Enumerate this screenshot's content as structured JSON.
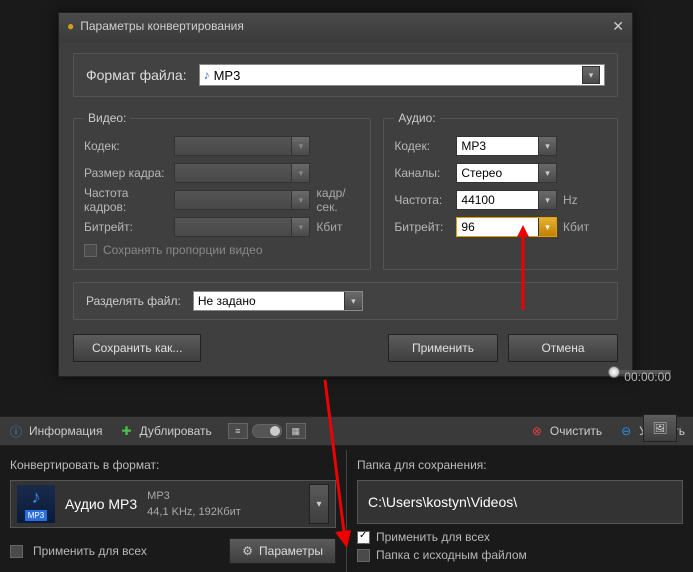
{
  "dialog": {
    "title": "Параметры конвертирования",
    "format_label": "Формат файла:",
    "format_value": "MP3",
    "video": {
      "legend": "Видео:",
      "codec": "Кодек:",
      "framesize": "Размер кадра:",
      "fps": "Частота кадров:",
      "fps_unit": "кадр/сек.",
      "bitrate": "Битрейт:",
      "bitrate_unit": "Кбит",
      "keep_ratio": "Сохранять пропорции видео"
    },
    "audio": {
      "legend": "Аудио:",
      "codec": "Кодек:",
      "codec_val": "MP3",
      "channels": "Каналы:",
      "channels_val": "Стерео",
      "freq": "Частота:",
      "freq_val": "44100",
      "freq_unit": "Hz",
      "bitrate": "Битрейт:",
      "bitrate_val": "96",
      "bitrate_unit": "Кбит"
    },
    "split_label": "Разделять файл:",
    "split_value": "Не задано",
    "save_as": "Сохранить как...",
    "apply": "Применить",
    "cancel": "Отмена"
  },
  "timeline": {
    "time": "00:00:00"
  },
  "toolbar": {
    "info": "Информация",
    "duplicate": "Дублировать",
    "clear": "Очистить",
    "delete": "Удалить"
  },
  "convert": {
    "heading": "Конвертировать в формат:",
    "name": "Аудио MP3",
    "line1": "MP3",
    "line2": "44,1 KHz, 192Кбит",
    "mp3_tag": "MP3",
    "apply_all": "Применить для всех",
    "params": "Параметры"
  },
  "save": {
    "heading": "Папка для сохранения:",
    "path": "C:\\Users\\kostyn\\Videos\\",
    "apply_all": "Применить для всех",
    "same_folder": "Папка с исходным файлом"
  }
}
